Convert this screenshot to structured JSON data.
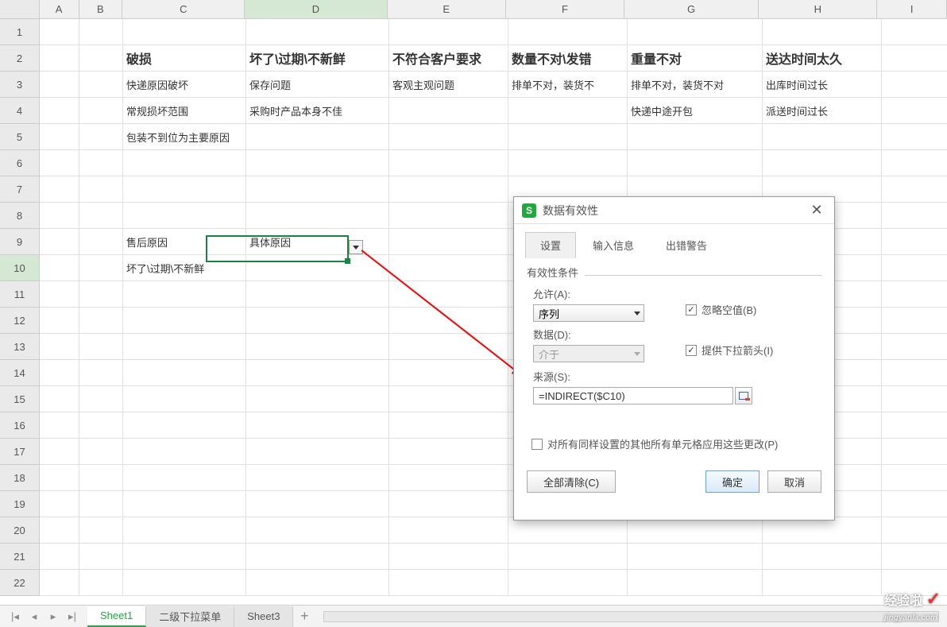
{
  "columns": [
    "A",
    "B",
    "C",
    "D",
    "E",
    "F",
    "G",
    "H",
    "I"
  ],
  "rows_count": 22,
  "active_col": "D",
  "active_row": 10,
  "cells": {
    "C2": {
      "text": "破损",
      "bold": true
    },
    "D2": {
      "text": "坏了\\过期\\不新鲜",
      "bold": true
    },
    "E2": {
      "text": "不符合客户要求",
      "bold": true
    },
    "F2": {
      "text": "数量不对\\发错",
      "bold": true
    },
    "G2": {
      "text": "重量不对",
      "bold": true
    },
    "H2": {
      "text": "送达时间太久",
      "bold": true
    },
    "C3": {
      "text": "快递原因破坏"
    },
    "D3": {
      "text": "保存问题"
    },
    "E3": {
      "text": "客观主观问题"
    },
    "F3": {
      "text": "排单不对，装货不"
    },
    "G3": {
      "text": "排单不对，装货不对"
    },
    "H3": {
      "text": "出库时间过长"
    },
    "C4": {
      "text": "常规损坏范围"
    },
    "D4": {
      "text": "采购时产品本身不佳"
    },
    "G4": {
      "text": "快递中途开包"
    },
    "H4": {
      "text": "派送时间过长"
    },
    "C5": {
      "text": "包装不到位为主要原因"
    },
    "C9": {
      "text": "售后原因"
    },
    "D9": {
      "text": "具体原因"
    },
    "C10": {
      "text": "坏了\\过期\\不新鲜"
    }
  },
  "dialog": {
    "title": "数据有效性",
    "tabs": [
      "设置",
      "输入信息",
      "出错警告"
    ],
    "fieldset": "有效性条件",
    "allow_label": "允许(A):",
    "allow_value": "序列",
    "data_label": "数据(D):",
    "data_value": "介于",
    "source_label": "来源(S):",
    "source_value": "=INDIRECT($C10)",
    "ignore_blank": "忽略空值(B)",
    "dropdown_arrow": "提供下拉箭头(I)",
    "apply_all": "对所有同样设置的其他所有单元格应用这些更改(P)",
    "clear_btn": "全部清除(C)",
    "ok_btn": "确定",
    "cancel_btn": "取消"
  },
  "sheets": [
    "Sheet1",
    "二级下拉菜单",
    "Sheet3"
  ],
  "watermark": {
    "main": "经验啦",
    "sub": "jingyanla.com"
  }
}
